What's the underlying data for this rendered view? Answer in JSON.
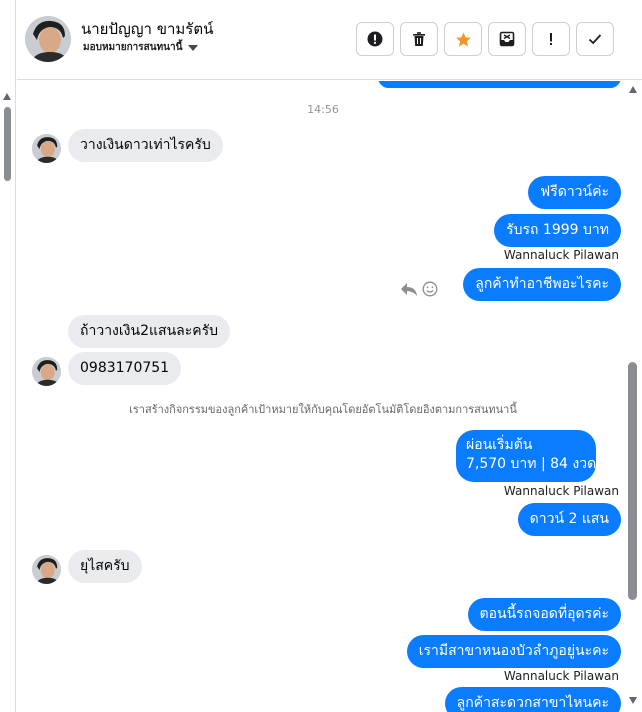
{
  "contact": {
    "name": "นายปัญญา ขามรัตน์",
    "assign_label": "มอบหมายการสนทนานี้"
  },
  "header_buttons": [
    {
      "name": "alert-button",
      "icon": "exclamation-circle-icon"
    },
    {
      "name": "delete-button",
      "icon": "trash-icon"
    },
    {
      "name": "star-button",
      "icon": "star-icon",
      "color": "#f5952b"
    },
    {
      "name": "archive-button",
      "icon": "archive-icon"
    },
    {
      "name": "important-button",
      "icon": "exclamation-icon"
    },
    {
      "name": "done-button",
      "icon": "check-icon"
    }
  ],
  "chat": {
    "timestamp": "14:56",
    "messages": {
      "in_1": "วางเงินดาวเท่าไรครับ",
      "out_1": "ฟรีดาวน์ค่ะ",
      "out_2": "รับรถ 1999 บาท",
      "sender_1": "Wannaluck Pilawan",
      "out_3": "ลูกค้าทำอาชีพอะไรคะ",
      "in_2": "ถ้าวางเงิน2แสนละครับ",
      "in_3": "0983170751",
      "system_note": "เราสร้างกิจกรรมของลูกค้าเป้าหมายให้กับคุณโดยอัตโนมัติโดยอิงตามการสนทนานี้",
      "out_4_line1": "ผ่อนเริ่มต้น",
      "out_4_line2": "7,570 บาท | 84 งวด",
      "sender_2": "Wannaluck Pilawan",
      "out_5": "ดาวน์  2 แสน",
      "in_4": "ยุไสครับ",
      "out_6": "ตอนนี้รถจอดที่อุดรค่ะ",
      "out_7": "เรามีสาขาหนองบัวลำภูอยู่นะคะ",
      "sender_3": "Wannaluck Pilawan",
      "out_8": "ลูกค้าสะดวกสาขาไหนคะ"
    }
  },
  "colors": {
    "outgoing_bubble": "#0a7cff",
    "incoming_bubble": "#e9ebee"
  }
}
